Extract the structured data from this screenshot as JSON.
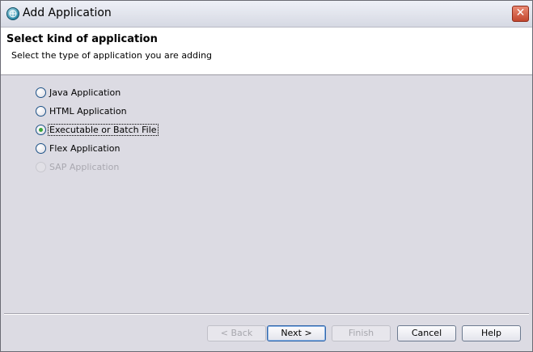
{
  "window": {
    "title": "Add Application"
  },
  "header": {
    "title": "Select kind of application",
    "subtitle": "Select the type of application you are adding"
  },
  "options": [
    {
      "label": "Java Application",
      "checked": false,
      "enabled": true
    },
    {
      "label": "HTML Application",
      "checked": false,
      "enabled": true
    },
    {
      "label": "Executable or Batch File",
      "checked": true,
      "enabled": true
    },
    {
      "label": "Flex Application",
      "checked": false,
      "enabled": true
    },
    {
      "label": "SAP Application",
      "checked": false,
      "enabled": false
    }
  ],
  "buttons": {
    "back": "< Back",
    "next": "Next >",
    "finish": "Finish",
    "cancel": "Cancel",
    "help": "Help"
  },
  "icons": {
    "app": "globe-icon",
    "close": "close-icon"
  },
  "colors": {
    "dialog_background": "#dcdbe3",
    "header_background": "#ffffff",
    "close_button": "#c3462d",
    "radio_checked_dot": "#3aa53a"
  }
}
